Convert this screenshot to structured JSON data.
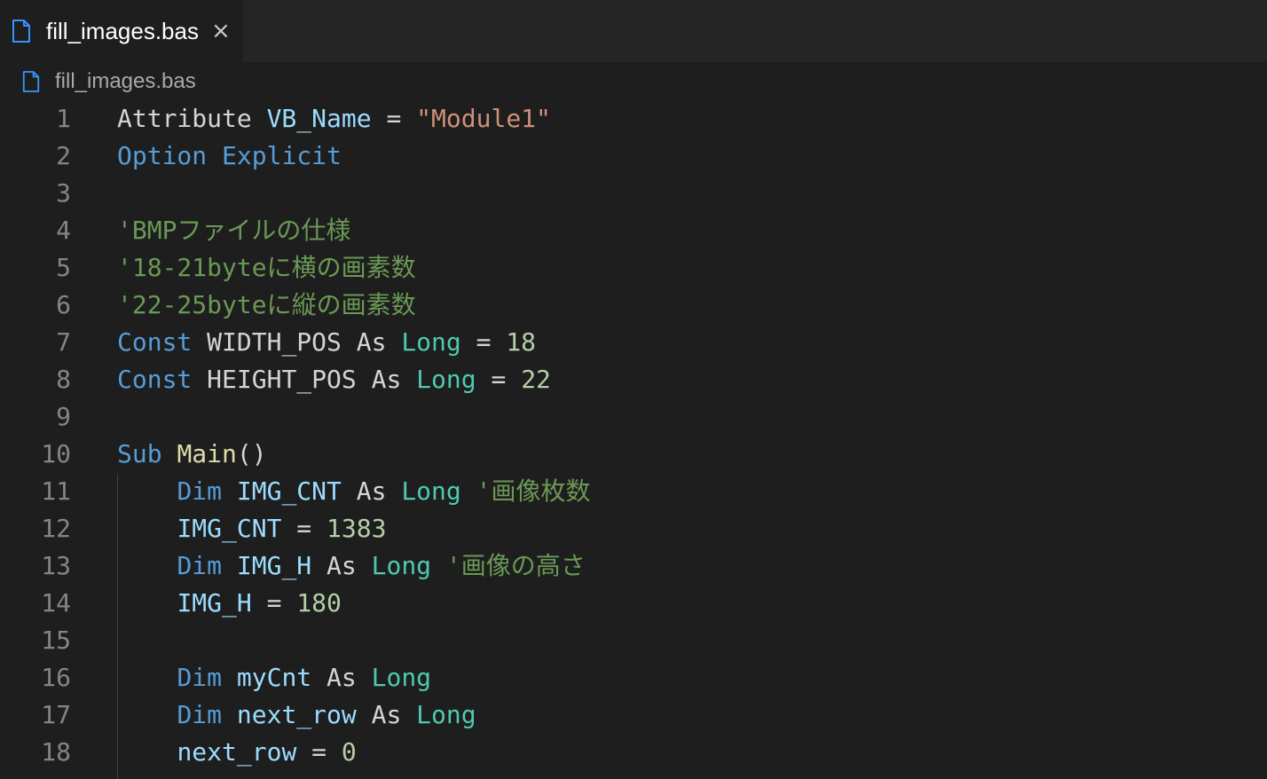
{
  "tab": {
    "label": "fill_images.bas",
    "close_icon": "×"
  },
  "breadcrumb": {
    "label": "fill_images.bas"
  },
  "colors": {
    "keyword": "#569cd6",
    "type": "#4ec9b0",
    "variable": "#9cdcfe",
    "function": "#dcdcaa",
    "string": "#ce9178",
    "number": "#b5cea8",
    "comment": "#6a9955",
    "plain": "#d4d4d4",
    "line_number": "#858585",
    "accent_icon": "#3794ff"
  },
  "lines": [
    {
      "n": "1",
      "tokens": [
        {
          "t": "Attribute ",
          "c": "plain"
        },
        {
          "t": "VB_Name",
          "c": "variable"
        },
        {
          "t": " = ",
          "c": "plain"
        },
        {
          "t": "\"Module1\"",
          "c": "string"
        }
      ]
    },
    {
      "n": "2",
      "tokens": [
        {
          "t": "Option",
          "c": "keyword"
        },
        {
          "t": " ",
          "c": "plain"
        },
        {
          "t": "Explicit",
          "c": "keyword"
        }
      ]
    },
    {
      "n": "3",
      "tokens": []
    },
    {
      "n": "4",
      "tokens": [
        {
          "t": "'BMPファイルの仕様",
          "c": "comment"
        }
      ]
    },
    {
      "n": "5",
      "tokens": [
        {
          "t": "'18-21byteに横の画素数",
          "c": "comment"
        }
      ]
    },
    {
      "n": "6",
      "tokens": [
        {
          "t": "'22-25byteに縦の画素数",
          "c": "comment"
        }
      ]
    },
    {
      "n": "7",
      "tokens": [
        {
          "t": "Const",
          "c": "keyword"
        },
        {
          "t": " WIDTH_POS As ",
          "c": "plain"
        },
        {
          "t": "Long",
          "c": "type"
        },
        {
          "t": " = ",
          "c": "plain"
        },
        {
          "t": "18",
          "c": "number"
        }
      ]
    },
    {
      "n": "8",
      "tokens": [
        {
          "t": "Const",
          "c": "keyword"
        },
        {
          "t": " HEIGHT_POS As ",
          "c": "plain"
        },
        {
          "t": "Long",
          "c": "type"
        },
        {
          "t": " = ",
          "c": "plain"
        },
        {
          "t": "22",
          "c": "number"
        }
      ]
    },
    {
      "n": "9",
      "tokens": []
    },
    {
      "n": "10",
      "tokens": [
        {
          "t": "Sub",
          "c": "keyword"
        },
        {
          "t": " ",
          "c": "plain"
        },
        {
          "t": "Main",
          "c": "function"
        },
        {
          "t": "()",
          "c": "plain"
        }
      ]
    },
    {
      "n": "11",
      "tokens": [
        {
          "t": "    ",
          "c": "plain"
        },
        {
          "t": "Dim",
          "c": "keyword"
        },
        {
          "t": " ",
          "c": "plain"
        },
        {
          "t": "IMG_CNT",
          "c": "variable"
        },
        {
          "t": " As ",
          "c": "plain"
        },
        {
          "t": "Long",
          "c": "type"
        },
        {
          "t": " ",
          "c": "plain"
        },
        {
          "t": "'画像枚数",
          "c": "comment"
        }
      ]
    },
    {
      "n": "12",
      "tokens": [
        {
          "t": "    ",
          "c": "plain"
        },
        {
          "t": "IMG_CNT",
          "c": "variable"
        },
        {
          "t": " = ",
          "c": "plain"
        },
        {
          "t": "1383",
          "c": "number"
        }
      ]
    },
    {
      "n": "13",
      "tokens": [
        {
          "t": "    ",
          "c": "plain"
        },
        {
          "t": "Dim",
          "c": "keyword"
        },
        {
          "t": " ",
          "c": "plain"
        },
        {
          "t": "IMG_H",
          "c": "variable"
        },
        {
          "t": " As ",
          "c": "plain"
        },
        {
          "t": "Long",
          "c": "type"
        },
        {
          "t": " ",
          "c": "plain"
        },
        {
          "t": "'画像の高さ",
          "c": "comment"
        }
      ]
    },
    {
      "n": "14",
      "tokens": [
        {
          "t": "    ",
          "c": "plain"
        },
        {
          "t": "IMG_H",
          "c": "variable"
        },
        {
          "t": " = ",
          "c": "plain"
        },
        {
          "t": "180",
          "c": "number"
        }
      ]
    },
    {
      "n": "15",
      "tokens": []
    },
    {
      "n": "16",
      "tokens": [
        {
          "t": "    ",
          "c": "plain"
        },
        {
          "t": "Dim",
          "c": "keyword"
        },
        {
          "t": " ",
          "c": "plain"
        },
        {
          "t": "myCnt",
          "c": "variable"
        },
        {
          "t": " As ",
          "c": "plain"
        },
        {
          "t": "Long",
          "c": "type"
        }
      ]
    },
    {
      "n": "17",
      "tokens": [
        {
          "t": "    ",
          "c": "plain"
        },
        {
          "t": "Dim",
          "c": "keyword"
        },
        {
          "t": " ",
          "c": "plain"
        },
        {
          "t": "next_row",
          "c": "variable"
        },
        {
          "t": " As ",
          "c": "plain"
        },
        {
          "t": "Long",
          "c": "type"
        }
      ]
    },
    {
      "n": "18",
      "tokens": [
        {
          "t": "    ",
          "c": "plain"
        },
        {
          "t": "next_row",
          "c": "variable"
        },
        {
          "t": " = ",
          "c": "plain"
        },
        {
          "t": "0",
          "c": "number"
        }
      ]
    }
  ]
}
